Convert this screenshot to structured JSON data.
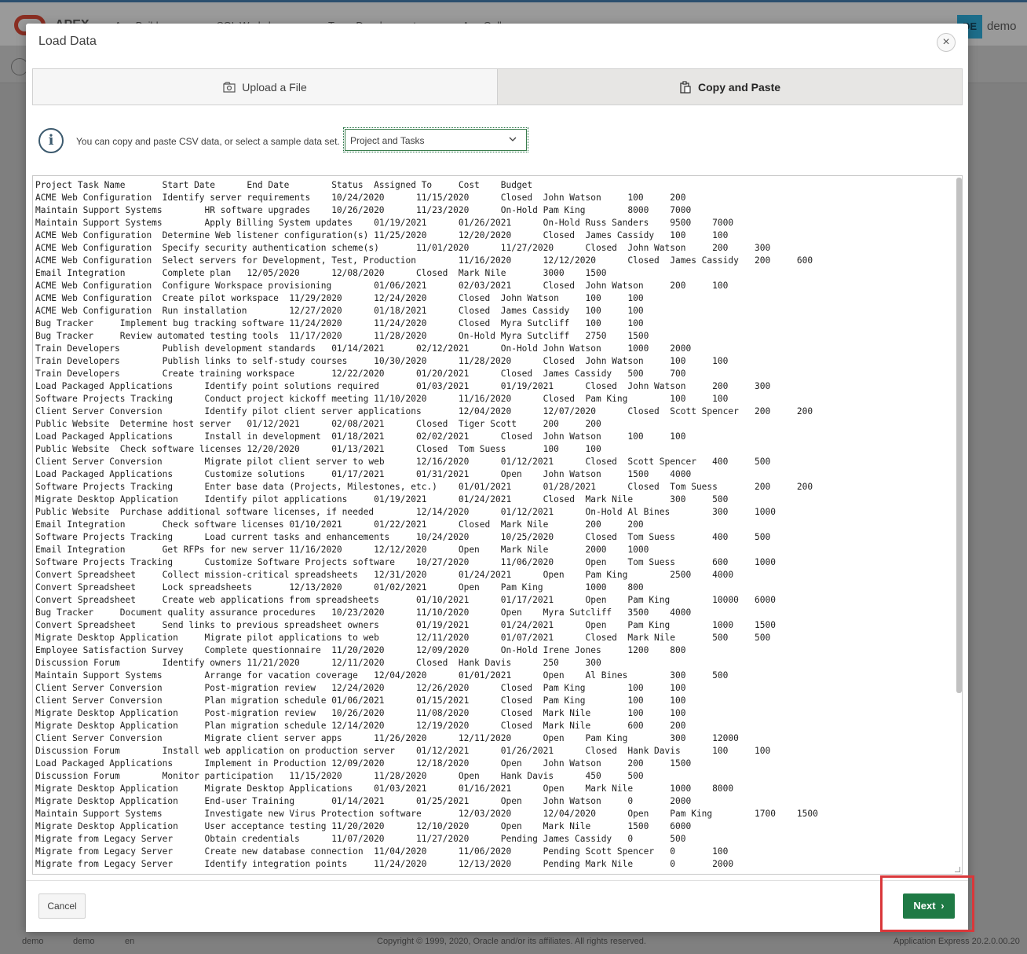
{
  "background": {
    "app_logo_text": "APEX",
    "nav": [
      "App Builder",
      "SQL Workshop",
      "Team Development",
      "App Gallery"
    ],
    "user_initials": "DE",
    "username": "demo",
    "footer": {
      "user": "demo",
      "workspace": "demo",
      "language": "en",
      "copyright": "Copyright © 1999, 2020, Oracle and/or its affiliates. All rights reserved.",
      "version": "Application Express 20.2.0.00.20"
    }
  },
  "dialog": {
    "title": "Load Data",
    "close_label": "×",
    "tabs": [
      {
        "label": "Upload a File",
        "icon": "upload-file-icon",
        "active": false
      },
      {
        "label": "Copy and Paste",
        "icon": "clipboard-icon",
        "active": true
      }
    ],
    "info_text": "You can copy and paste CSV data, or select a sample data set.",
    "sample_select": {
      "value": "Project and Tasks"
    },
    "data_text": "Project\tTask Name\tStart Date\tEnd Date\tStatus\tAssigned To\tCost\tBudget\nACME Web Configuration\tIdentify server requirements\t10/24/2020\t11/15/2020\tClosed\tJohn Watson\t100\t200\nMaintain Support Systems\tHR software upgrades\t10/26/2020\t11/23/2020\tOn-Hold\tPam King\t8000\t7000\nMaintain Support Systems\tApply Billing System updates\t01/19/2021\t01/26/2021\tOn-Hold\tRuss Sanders\t9500\t7000\nACME Web Configuration\tDetermine Web listener configuration(s)\t11/25/2020\t12/20/2020\tClosed\tJames Cassidy\t100\t100\nACME Web Configuration\tSpecify security authentication scheme(s)\t11/01/2020\t11/27/2020\tClosed\tJohn Watson\t200\t300\nACME Web Configuration\tSelect servers for Development, Test, Production\t11/16/2020\t12/12/2020\tClosed\tJames Cassidy\t200\t600\nEmail Integration\tComplete plan\t12/05/2020\t12/08/2020\tClosed\tMark Nile\t3000\t1500\nACME Web Configuration\tConfigure Workspace provisioning\t01/06/2021\t02/03/2021\tClosed\tJohn Watson\t200\t100\nACME Web Configuration\tCreate pilot workspace\t11/29/2020\t12/24/2020\tClosed\tJohn Watson\t100\t100\nACME Web Configuration\tRun installation\t12/27/2020\t01/18/2021\tClosed\tJames Cassidy\t100\t100\nBug Tracker\tImplement bug tracking software\t11/24/2020\t11/24/2020\tClosed\tMyra Sutcliff\t100\t100\nBug Tracker\tReview automated testing tools\t11/17/2020\t11/28/2020\tOn-Hold\tMyra Sutcliff\t2750\t1500\nTrain Developers\tPublish development standards\t01/14/2021\t02/12/2021\tOn-Hold\tJohn Watson\t1000\t2000\nTrain Developers\tPublish links to self-study courses\t10/30/2020\t11/28/2020\tClosed\tJohn Watson\t100\t100\nTrain Developers\tCreate training workspace\t12/22/2020\t01/20/2021\tClosed\tJames Cassidy\t500\t700\nLoad Packaged Applications\tIdentify point solutions required\t01/03/2021\t01/19/2021\tClosed\tJohn Watson\t200\t300\nSoftware Projects Tracking\tConduct project kickoff meeting\t11/10/2020\t11/16/2020\tClosed\tPam King\t100\t100\nClient Server Conversion\tIdentify pilot client server applications\t12/04/2020\t12/07/2020\tClosed\tScott Spencer\t200\t200\nPublic Website\tDetermine host server\t01/12/2021\t02/08/2021\tClosed\tTiger Scott\t200\t200\nLoad Packaged Applications\tInstall in development\t01/18/2021\t02/02/2021\tClosed\tJohn Watson\t100\t100\nPublic Website\tCheck software licenses\t12/20/2020\t01/13/2021\tClosed\tTom Suess\t100\t100\nClient Server Conversion\tMigrate pilot client server to web\t12/16/2020\t01/12/2021\tClosed\tScott Spencer\t400\t500\nLoad Packaged Applications\tCustomize solutions\t01/17/2021\t01/31/2021\tOpen\tJohn Watson\t1500\t4000\nSoftware Projects Tracking\tEnter base data (Projects, Milestones, etc.)\t01/01/2021\t01/28/2021\tClosed\tTom Suess\t200\t200\nMigrate Desktop Application\tIdentify pilot applications\t01/19/2021\t01/24/2021\tClosed\tMark Nile\t300\t500\nPublic Website\tPurchase additional software licenses, if needed\t12/14/2020\t01/12/2021\tOn-Hold\tAl Bines\t300\t1000\nEmail Integration\tCheck software licenses\t01/10/2021\t01/22/2021\tClosed\tMark Nile\t200\t200\nSoftware Projects Tracking\tLoad current tasks and enhancements\t10/24/2020\t10/25/2020\tClosed\tTom Suess\t400\t500\nEmail Integration\tGet RFPs for new server\t11/16/2020\t12/12/2020\tOpen\tMark Nile\t2000\t1000\nSoftware Projects Tracking\tCustomize Software Projects software\t10/27/2020\t11/06/2020\tOpen\tTom Suess\t600\t1000\nConvert Spreadsheet\tCollect mission-critical spreadsheets\t12/31/2020\t01/24/2021\tOpen\tPam King\t2500\t4000\nConvert Spreadsheet\tLock spreadsheets\t12/13/2020\t01/02/2021\tOpen\tPam King\t1000\t800\nConvert Spreadsheet\tCreate web applications from spreadsheets\t01/10/2021\t01/17/2021\tOpen\tPam King\t10000\t6000\nBug Tracker\tDocument quality assurance procedures\t10/23/2020\t11/10/2020\tOpen\tMyra Sutcliff\t3500\t4000\nConvert Spreadsheet\tSend links to previous spreadsheet owners\t01/19/2021\t01/24/2021\tOpen\tPam King\t1000\t1500\nMigrate Desktop Application\tMigrate pilot applications to web\t12/11/2020\t01/07/2021\tClosed\tMark Nile\t500\t500\nEmployee Satisfaction Survey\tComplete questionnaire\t11/20/2020\t12/09/2020\tOn-Hold\tIrene Jones\t1200\t800\nDiscussion Forum\tIdentify owners\t11/21/2020\t12/11/2020\tClosed\tHank Davis\t250\t300\nMaintain Support Systems\tArrange for vacation coverage\t12/04/2020\t01/01/2021\tOpen\tAl Bines\t300\t500\nClient Server Conversion\tPost-migration review\t12/24/2020\t12/26/2020\tClosed\tPam King\t100\t100\nClient Server Conversion\tPlan migration schedule\t01/06/2021\t01/15/2021\tClosed\tPam King\t100\t100\nMigrate Desktop Application\tPost-migration review\t10/26/2020\t11/08/2020\tClosed\tMark Nile\t100\t100\nMigrate Desktop Application\tPlan migration schedule\t12/14/2020\t12/19/2020\tClosed\tMark Nile\t600\t200\nClient Server Conversion\tMigrate client server apps\t11/26/2020\t12/11/2020\tOpen\tPam King\t300\t12000\nDiscussion Forum\tInstall web application on production server\t01/12/2021\t01/26/2021\tClosed\tHank Davis\t100\t100\nLoad Packaged Applications\tImplement in Production\t12/09/2020\t12/18/2020\tOpen\tJohn Watson\t200\t1500\nDiscussion Forum\tMonitor participation\t11/15/2020\t11/28/2020\tOpen\tHank Davis\t450\t500\nMigrate Desktop Application\tMigrate Desktop Applications\t01/03/2021\t01/16/2021\tOpen\tMark Nile\t1000\t8000\nMigrate Desktop Application\tEnd-user Training\t01/14/2021\t01/25/2021\tOpen\tJohn Watson\t0\t2000\nMaintain Support Systems\tInvestigate new Virus Protection software\t12/03/2020\t12/04/2020\tOpen\tPam King\t1700\t1500\nMigrate Desktop Application\tUser acceptance testing\t11/20/2020\t12/10/2020\tOpen\tMark Nile\t1500\t6000\nMigrate from Legacy Server\tObtain credentials\t11/07/2020\t11/27/2020\tPending\tJames Cassidy\t0\t500\nMigrate from Legacy Server\tCreate new database connection\t11/04/2020\t11/06/2020\tPending\tScott Spencer\t0\t100\nMigrate from Legacy Server\tIdentify integration points\t11/24/2020\t12/13/2020\tPending\tMark Nile\t0\t2000",
    "buttons": {
      "cancel": "Cancel",
      "next": "Next"
    }
  }
}
